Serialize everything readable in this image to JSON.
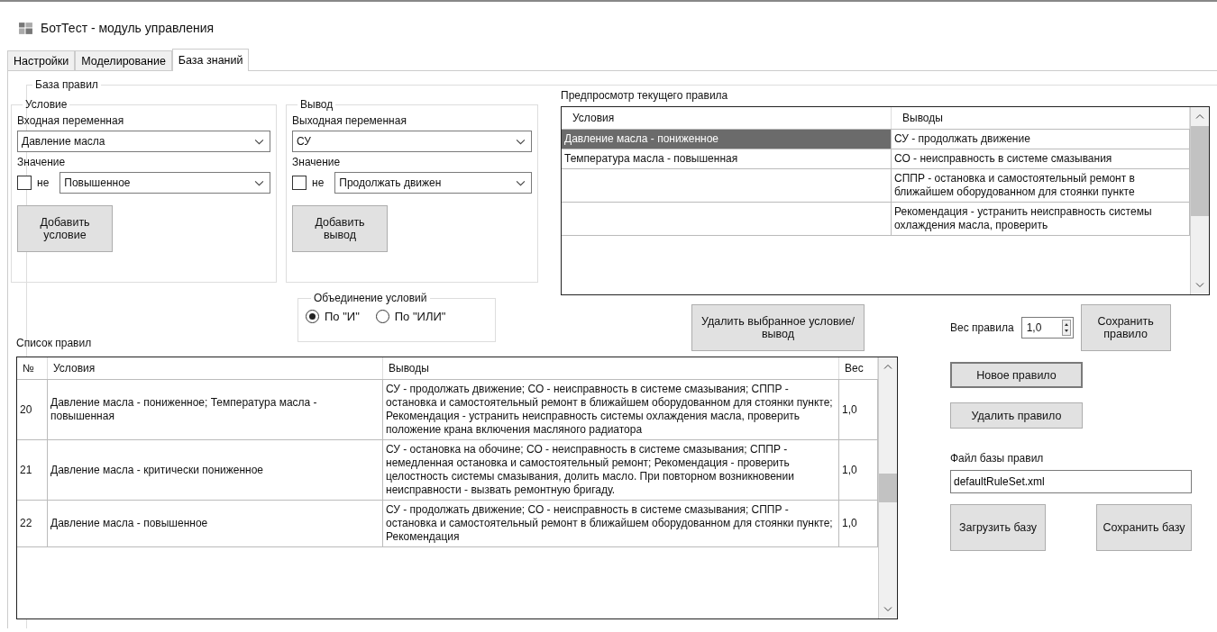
{
  "window": {
    "title": "БотТест - модуль управления"
  },
  "tabs": [
    {
      "label": "Настройки",
      "selected": false
    },
    {
      "label": "Моделирование",
      "selected": false
    },
    {
      "label": "База знаний",
      "selected": true
    }
  ],
  "rule_base": {
    "title": "База правил",
    "condition": {
      "title": "Условие",
      "variable_label": "Входная переменная",
      "variable_value": "Давление масла",
      "value_label": "Значение",
      "negate": {
        "label": "не",
        "checked": false
      },
      "value": "Повышенное",
      "add_button": "Добавить условие"
    },
    "conclusion": {
      "title": "Вывод",
      "variable_label": "Выходная переменная",
      "variable_value": "СУ",
      "value_label": "Значение",
      "negate": {
        "label": "не",
        "checked": false
      },
      "value": "Продолжать движен",
      "add_button": "Добавить вывод"
    },
    "combine": {
      "title": "Объединение условий",
      "options": [
        {
          "label": "По \"И\"",
          "selected": true
        },
        {
          "label": "По \"ИЛИ\"",
          "selected": false
        }
      ]
    },
    "preview": {
      "title": "Предпросмотр текущего правила",
      "columns": [
        "Условия",
        "Выводы"
      ],
      "rows": [
        {
          "conditions": "Давление масла - пониженное",
          "conclusions": "СУ - продолжать движение",
          "selected": true
        },
        {
          "conditions": "Температура масла - повышенная",
          "conclusions": "СО - неисправность в системе смазывания",
          "selected": false
        },
        {
          "conditions": "",
          "conclusions": "СППР - остановка и самостоятельный ремонт в ближайшем оборудованном для стоянки пункте",
          "selected": false
        },
        {
          "conditions": "",
          "conclusions": "Рекомендация - устранить неисправность системы охлаждения масла, проверить",
          "selected": false
        }
      ]
    },
    "delete_button": "Удалить выбранное условие/вывод",
    "weight": {
      "label": "Вес правила",
      "value": "1,0"
    },
    "save_rule_button": "Сохранить правило",
    "rules_list": {
      "title": "Список правил",
      "columns": [
        "№",
        "Условия",
        "Выводы",
        "Вес"
      ],
      "rows": [
        {
          "number": "20",
          "conditions": "Давление масла - пониженное; Температура масла - повышенная",
          "conclusions": "СУ - продолжать движение; СО - неисправность в системе смазывания; СППР - остановка и самостоятельный ремонт в ближайшем оборудованном для стоянки пункте; Рекомендация - устранить неисправность системы охлаждения масла, проверить положение крана включения масляного радиатора",
          "weight": "1,0"
        },
        {
          "number": "21",
          "conditions": "Давление масла - критически пониженное",
          "conclusions": "СУ - остановка на обочине; СО - неисправность в системе смазывания; СППР - немедленная остановка и самостоятельный ремонт; Рекомендация - проверить целостность системы смазывания, долить масло. При повторном возникновении неисправности - вызвать ремонтную бригаду.",
          "weight": "1,0"
        },
        {
          "number": "22",
          "conditions": "Давление масла - повышенное",
          "conclusions": "СУ - продолжать движение; СО - неисправность в системе смазывания; СППР - остановка и самостоятельный ремонт в ближайшем оборудованном для стоянки пункте; Рекомендация",
          "weight": "1,0"
        }
      ]
    },
    "new_rule_button": {
      "label": "Новое правило",
      "default": true
    },
    "delete_rule_button": "Удалить правило",
    "file": {
      "label": "Файл базы правил",
      "value": "defaultRuleSet.xml"
    },
    "load_button": "Загрузить базу",
    "save_base_button": "Сохранить базу"
  }
}
